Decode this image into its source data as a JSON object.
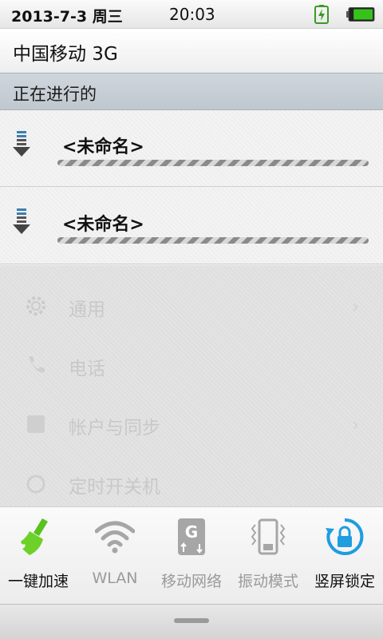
{
  "status_bar": {
    "date": "2013-7-3 周三",
    "time": "20:03",
    "charging_icon": "battery-charging-icon",
    "battery_icon": "battery-icon",
    "battery_level": 0.85,
    "battery_color": "#37c21b"
  },
  "carrier": "中国移动 3G",
  "section_header": "正在进行的",
  "downloads": [
    {
      "title": "<未命名>",
      "icon": "download-icon"
    },
    {
      "title": "<未命名>",
      "icon": "download-icon"
    }
  ],
  "background_items": [
    {
      "label": "通用",
      "icon": "gear-icon"
    },
    {
      "label": "电话",
      "icon": "phone-icon"
    },
    {
      "label": "帐户与同步",
      "icon": "account-sync-icon"
    },
    {
      "label": "定时开关机",
      "icon": "power-icon"
    }
  ],
  "toggles": [
    {
      "label": "一键加速",
      "icon": "broom-icon",
      "active": true,
      "color": "#58c21e"
    },
    {
      "label": "WLAN",
      "icon": "wifi-icon",
      "active": false,
      "color": "#9a9a9a"
    },
    {
      "label": "移动网络",
      "icon": "mobile-network-g-icon",
      "active": false,
      "color": "#9a9a9a"
    },
    {
      "label": "振动模式",
      "icon": "vibrate-icon",
      "active": false,
      "color": "#9a9a9a"
    },
    {
      "label": "竖屏锁定",
      "icon": "rotation-lock-icon",
      "active": true,
      "color": "#1e9de0"
    }
  ]
}
